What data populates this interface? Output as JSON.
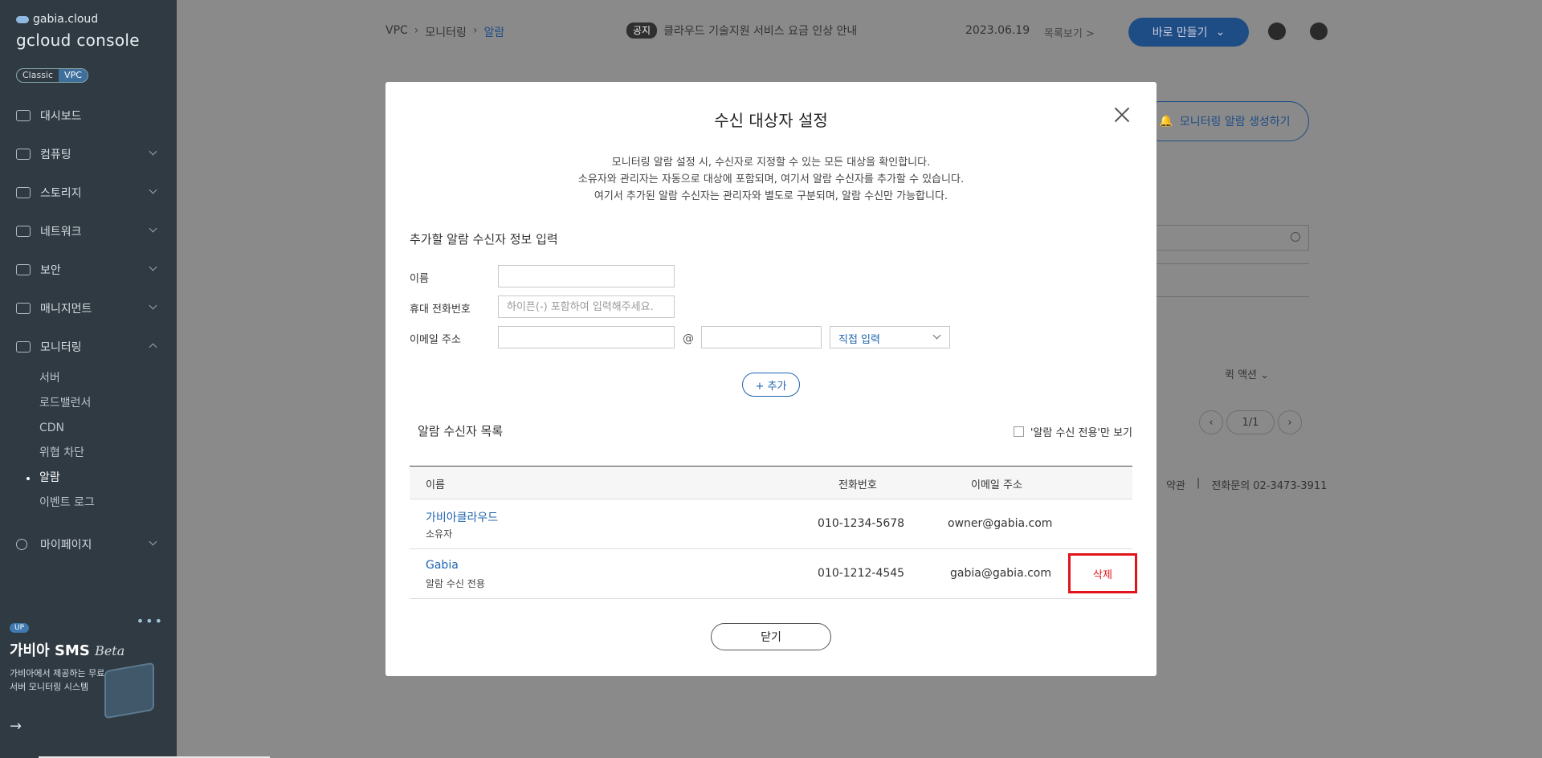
{
  "sidebar": {
    "brand_small": "gabia.cloud",
    "brand_big": "gcloud console",
    "mode_classic": "Classic",
    "mode_vpc": "VPC",
    "items": [
      {
        "label": "대시보드",
        "icon": "dashboard-icon",
        "expandable": false
      },
      {
        "label": "컴퓨팅",
        "icon": "chip-icon",
        "expandable": true
      },
      {
        "label": "스토리지",
        "icon": "storage-icon",
        "expandable": true
      },
      {
        "label": "네트워크",
        "icon": "network-icon",
        "expandable": true
      },
      {
        "label": "보안",
        "icon": "shield-icon",
        "expandable": true
      },
      {
        "label": "매니지먼트",
        "icon": "management-icon",
        "expandable": true
      },
      {
        "label": "모니터링",
        "icon": "monitor-icon",
        "expandable": true,
        "open": true
      }
    ],
    "subitems": [
      "서버",
      "로드밸런서",
      "CDN",
      "위협 차단",
      "알람",
      "이벤트 로그"
    ],
    "active_subitem": "알람",
    "mypage": "마이페이지",
    "promo": {
      "badge": "UP",
      "title": "가비아 SMS",
      "title_italic": "Beta",
      "desc": "가비아에서 제공하는 무료 서버 모니터링 시스템",
      "arrow": "→"
    }
  },
  "topbar": {
    "breadcrumb": [
      "VPC",
      "모니터링",
      "알람"
    ],
    "breadcrumb_sep": "›",
    "notice_tag": "공지",
    "notice_text": "클라우드 기술지원 서비스 요금 인상 안내",
    "notice_date": "2023.06.19",
    "notice_more": "목록보기 >",
    "create_button": "바로 만들기",
    "create_chevron": "⌄"
  },
  "background": {
    "alarm_button": "모니터링 알람 생성하기",
    "alarm_icon": "🔔",
    "quick_action": "퀵 액션 ⌄",
    "pager_prev": "‹",
    "pager_page": "1/1",
    "pager_next": "›",
    "footer_terms": "약관",
    "footer_sep": "|",
    "footer_phone": "전화문의 02-3473-3911"
  },
  "modal": {
    "title": "수신 대상자 설정",
    "desc_lines": [
      "모니터링 알람 설정 시, 수신자로 지정할 수 있는 모든 대상을 확인합니다.",
      "소유자와 관리자는 자동으로 대상에 포함되며, 여기서 알람 수신자를 추가할 수 있습니다.",
      "여기서 추가된 알람 수신자는 관리자와 별도로 구분되며, 알람 수신만 가능합니다."
    ],
    "form_title": "추가할 알람 수신자 정보 입력",
    "name_label": "이름",
    "name_value": "",
    "phone_label": "휴대 전화번호",
    "phone_placeholder": "하이픈(-) 포함하여 입력해주세요.",
    "email_label": "이메일 주소",
    "email_local": "",
    "at": "@",
    "email_domain": "",
    "domain_select": "직접 입력",
    "add_button": "+ 추가",
    "list_title": "알람 수신자 목록",
    "filter_label": "'알람 수신 전용'만 보기",
    "columns": {
      "name": "이름",
      "phone": "전화번호",
      "email": "이메일 주소"
    },
    "rows": [
      {
        "name": "가비아클라우드",
        "role": "소유자",
        "phone": "010-1234-5678",
        "email": "owner@gabia.com",
        "delete": ""
      },
      {
        "name": "Gabia",
        "role": "알람 수신 전용",
        "phone": "010-1212-4545",
        "email": "gabia@gabia.com",
        "delete": "삭제"
      }
    ],
    "close_button": "닫기"
  },
  "colors": {
    "accent": "#1e64b0",
    "sidebar_bg": "#2f3a42",
    "overlay": "#8a8a8a",
    "delete_red": "#e0141a"
  }
}
